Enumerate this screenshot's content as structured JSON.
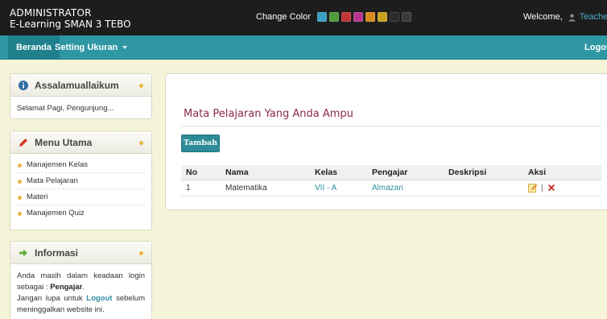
{
  "header": {
    "title_line1": "ADMINISTRATOR",
    "title_line2": "E-Learning SMAN 3 TEBO",
    "change_color_label": "Change Color",
    "swatches": [
      "#3a9fc0",
      "#4f9a3c",
      "#c13636",
      "#b73590",
      "#d98a1f",
      "#c9a21d",
      "#2a2a2a",
      "#3a3a3a"
    ],
    "welcome_label": "Welcome,",
    "username": "Teacher"
  },
  "nav": {
    "home": "Beranda",
    "setting": "Setting Ukuran",
    "logout": "Logout"
  },
  "sidebar": {
    "greeting_box": {
      "title": "Assalamuallaikum",
      "text": "Selamat Pagi, Pengunjung..."
    },
    "menu_box": {
      "title": "Menu Utama",
      "items": [
        "Manajemen Kelas",
        "Mata Pelajaran",
        "Materi",
        "Manajemen Quiz"
      ]
    },
    "info_box": {
      "title": "Informasi",
      "line1": "Anda masih dalam keadaan login sebagai :",
      "role": "Pengajar",
      "line2_pre": "Jangan lupa untuk",
      "logout_word": "Logout",
      "line2_post": "sebelum meninggalkan website ini."
    }
  },
  "main": {
    "title": "Mata Pelajaran Yang Anda Ampu",
    "add_button": "Tambah",
    "columns": [
      "No",
      "Nama",
      "Kelas",
      "Pengajar",
      "Deskripsi",
      "Aksi"
    ],
    "rows": [
      {
        "no": "1",
        "nama": "Matematika",
        "kelas": "VII - A",
        "pengajar": "Almazari",
        "deskripsi": ""
      }
    ],
    "action_separator": "|"
  },
  "colors": {
    "accent": "#2e97a3",
    "title": "#8b2a47",
    "link": "#2d8fa3"
  }
}
